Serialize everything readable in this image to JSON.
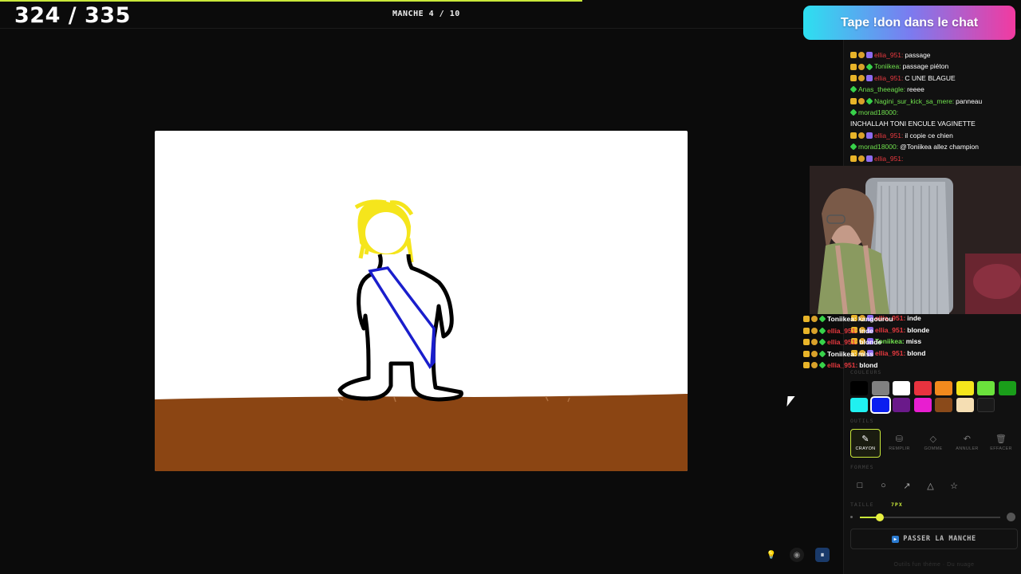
{
  "header": {
    "score": "324 / 335",
    "round": "MANCHE 4 / 10"
  },
  "banner": {
    "text": "Tape !don dans le chat"
  },
  "chat": [
    {
      "badges": [
        "crown",
        "gold",
        "sub"
      ],
      "user": "ellia_951:",
      "user_color": "red",
      "text": "passage"
    },
    {
      "badges": [
        "crown",
        "gold",
        "green"
      ],
      "user": "Toniikea:",
      "user_color": "green",
      "text": "passage piéton"
    },
    {
      "badges": [
        "crown",
        "gold",
        "sub"
      ],
      "user": "ellia_951:",
      "user_color": "red",
      "text": "C UNE BLAGUE"
    },
    {
      "badges": [
        "green"
      ],
      "user": "Anas_theeagle:",
      "user_color": "green",
      "text": "reeee"
    },
    {
      "badges": [
        "crown",
        "gold",
        "green"
      ],
      "user": "Nagini_sur_kick_sa_mere:",
      "user_color": "green",
      "text": "panneau"
    },
    {
      "badges": [
        "green"
      ],
      "user": "morad18000:",
      "user_color": "green",
      "text": ""
    },
    {
      "badges": [],
      "user": "",
      "user_color": "",
      "text": "INCHALLAH TONI ENCULE VAGINETTE"
    },
    {
      "badges": [
        "crown",
        "gold",
        "sub"
      ],
      "user": "ellia_951:",
      "user_color": "red",
      "text": "il copie ce chien"
    },
    {
      "badges": [
        "green"
      ],
      "user": "morad18000:",
      "user_color": "green",
      "text": "@Toniikea allez champion"
    },
    {
      "badges": [
        "crown",
        "gold",
        "sub"
      ],
      "user": "ellia_951:",
      "user_color": "red",
      "text": ""
    }
  ],
  "overlay_chat_right": [
    {
      "user": "ellia_951:",
      "text": "inde"
    },
    {
      "user": "ellia_951:",
      "text": "blonde"
    },
    {
      "user": "Toniikea:",
      "text": "miss"
    },
    {
      "user": "ellia_951:",
      "text": "blond"
    }
  ],
  "overlay_chat_left": [
    {
      "user": "Toniikea:",
      "user_color": "white",
      "text": "kangourou"
    },
    {
      "user": "ellia_951:",
      "user_color": "red",
      "text": "inde"
    },
    {
      "user": "ellia_951:",
      "user_color": "red",
      "text": "blonde"
    },
    {
      "user": "Toniikea:",
      "user_color": "white",
      "text": "miss"
    },
    {
      "user": "ellia_951:",
      "user_color": "red",
      "text": "blond"
    }
  ],
  "palette": {
    "label": "COULEURS",
    "colors_row1": [
      "#000000",
      "#808080",
      "#ffffff",
      "#e8333f",
      "#f28a1d",
      "#f5e51c",
      "#6be23c",
      "#1a9e1a"
    ],
    "colors_row2": [
      "#20f0f0",
      "#0a1ef0",
      "#6a1a8a",
      "#e81ed0",
      "#8a4a1a",
      "#f5deb3",
      "#1a1a1a"
    ],
    "selected": "#0a1ef0"
  },
  "tools": {
    "label": "OUTILS",
    "items": [
      {
        "label": "CRAYON",
        "icon": "pencil-icon",
        "glyph": "✎",
        "active": true
      },
      {
        "label": "REMPLIR",
        "icon": "bucket-icon",
        "glyph": "⛁",
        "active": false
      },
      {
        "label": "GOMME",
        "icon": "eraser-icon",
        "glyph": "◇",
        "active": false
      },
      {
        "label": "ANNULER",
        "icon": "undo-icon",
        "glyph": "↶",
        "active": false
      },
      {
        "label": "EFFACER",
        "icon": "trash-icon",
        "glyph": "🗑",
        "active": false
      }
    ]
  },
  "shapes": {
    "label": "FORMES",
    "items": [
      {
        "icon": "rectangle-icon",
        "glyph": "□"
      },
      {
        "icon": "ellipse-icon",
        "glyph": "○"
      },
      {
        "icon": "arrow-icon",
        "glyph": "↗"
      },
      {
        "icon": "triangle-icon",
        "glyph": "△"
      },
      {
        "icon": "star-icon",
        "glyph": "☆"
      }
    ]
  },
  "size": {
    "label": "TAILLE",
    "value": "7PX",
    "fraction": 0.14
  },
  "skip": {
    "label": "PASSER LA MANCHE",
    "icon": "skip-icon"
  },
  "footer": {
    "text": "Outils fun thème · Du nuage"
  },
  "colors": {
    "accent": "#c9e83a",
    "red_user": "#e8393f",
    "green_user": "#6fe04d",
    "ground": "#8b4513"
  }
}
